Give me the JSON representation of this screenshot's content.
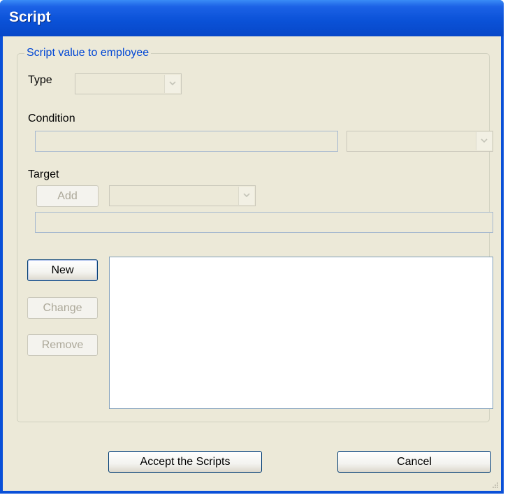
{
  "window": {
    "title": "Script"
  },
  "group": {
    "legend": "Script value to employee"
  },
  "type": {
    "label": "Type",
    "value": ""
  },
  "condition": {
    "label": "Condition",
    "text_value": "",
    "combo_value": ""
  },
  "target": {
    "label": "Target",
    "add_label": "Add",
    "combo_value": "",
    "text_value": ""
  },
  "actions": {
    "new_label": "New",
    "change_label": "Change",
    "remove_label": "Remove"
  },
  "footer": {
    "accept_label": "Accept the Scripts",
    "cancel_label": "Cancel"
  },
  "icons": {
    "dropdown": "chevron-down-icon",
    "grip": "resize-grip-icon"
  }
}
